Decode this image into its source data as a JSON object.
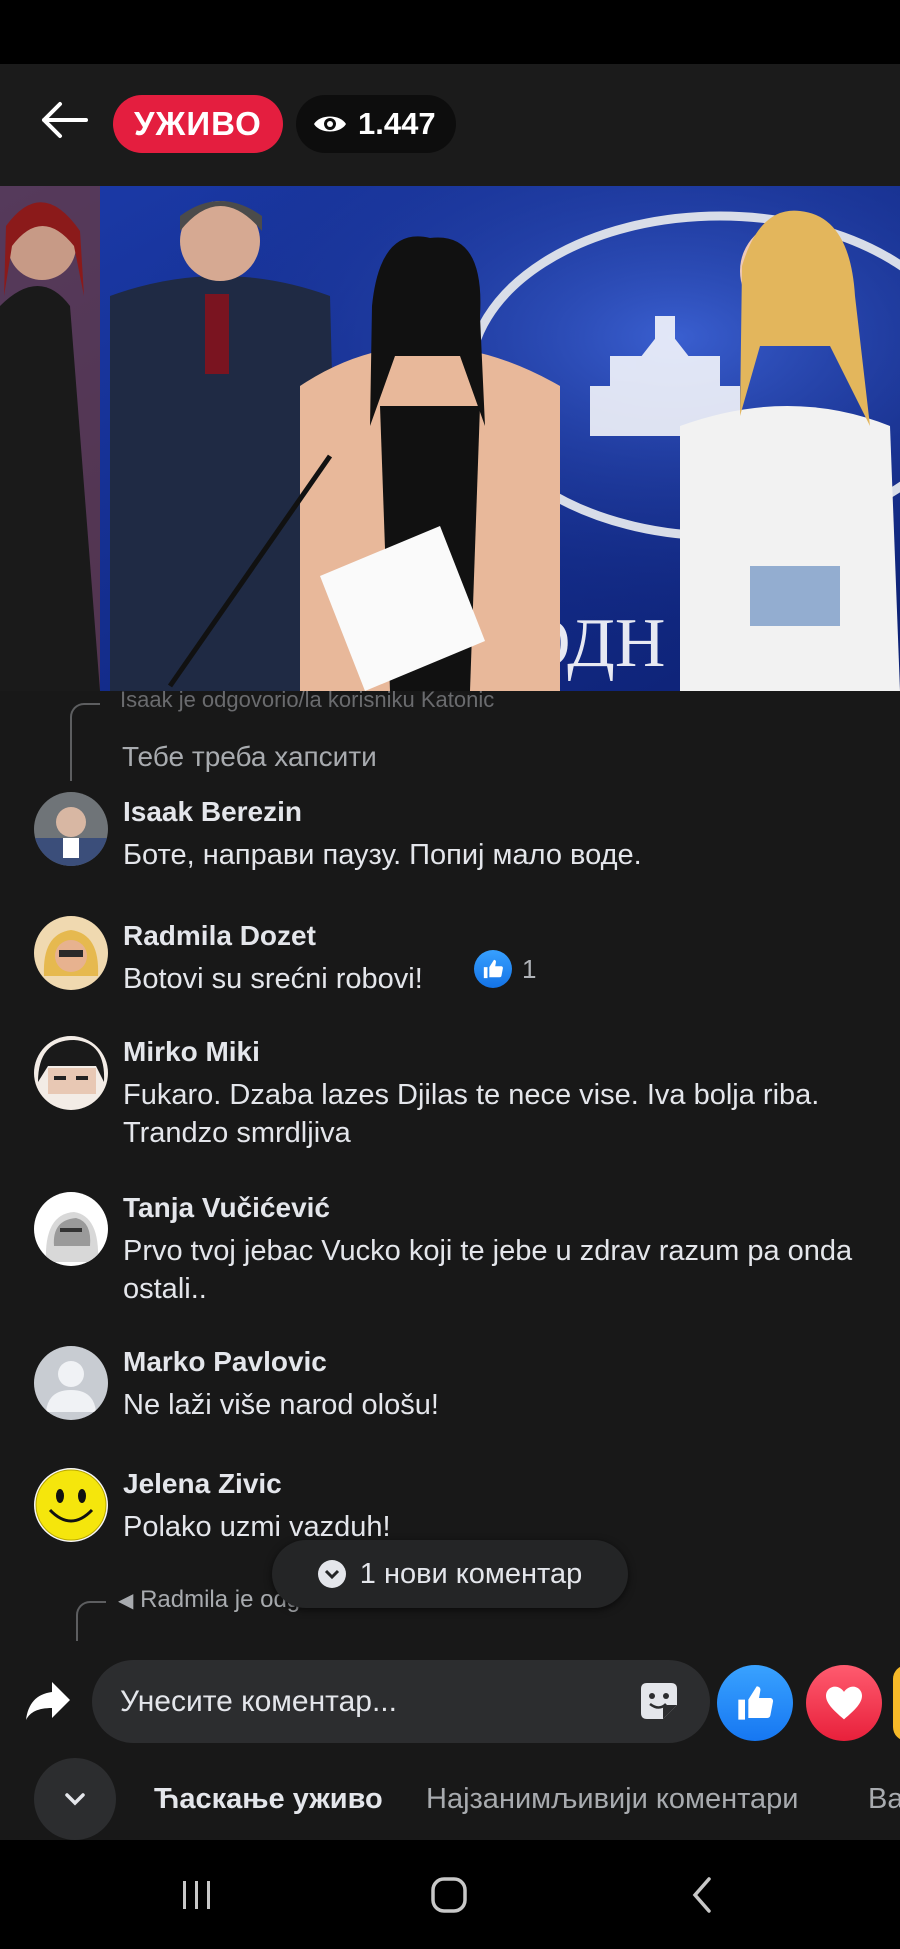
{
  "header": {
    "live_label": "УЖИВО",
    "viewer_count": "1.447"
  },
  "comments": {
    "partial_reply_trace": "Isaak je odgovorio/la korisniku Katonic",
    "previous_comment_text": "Тебе треба хапсити",
    "items": [
      {
        "name": "Isaak Berezin",
        "text": "Боте, направи паузу. Попиј мало воде."
      },
      {
        "name": "Radmila Dozet",
        "text": "Botovi su srećni robovi!",
        "likes": "1"
      },
      {
        "name": "Mirko Miki",
        "text": "Fukaro. Dzaba lazes Djilas te nece vise. Iva bolja riba. Trandzo smrdljiva"
      },
      {
        "name": "Tanja Vučićević",
        "text": "Prvo tvoj jebac Vucko koji te jebe u zdrav razum pa onda ostali.."
      },
      {
        "name": "Marko Pavlovic",
        "text": "Ne laži više narod ološu!"
      },
      {
        "name": "Jelena Zivic",
        "text": "Polako uzmi vazduh!"
      }
    ],
    "new_comments_pill": "1 нови коментар",
    "reply_trace": "Radmila je odgovorio/la korisniku Radmila"
  },
  "composer": {
    "placeholder": "Унесите коментар..."
  },
  "tabs": {
    "live_chat": "Ћаскање уживо",
    "top_comments": "Најзанимљивији коментари",
    "more": "Ва"
  },
  "colors": {
    "live_badge": "#e41e3f",
    "like_blue": "#1877f2",
    "love_red": "#e8203b",
    "background": "#181818"
  }
}
